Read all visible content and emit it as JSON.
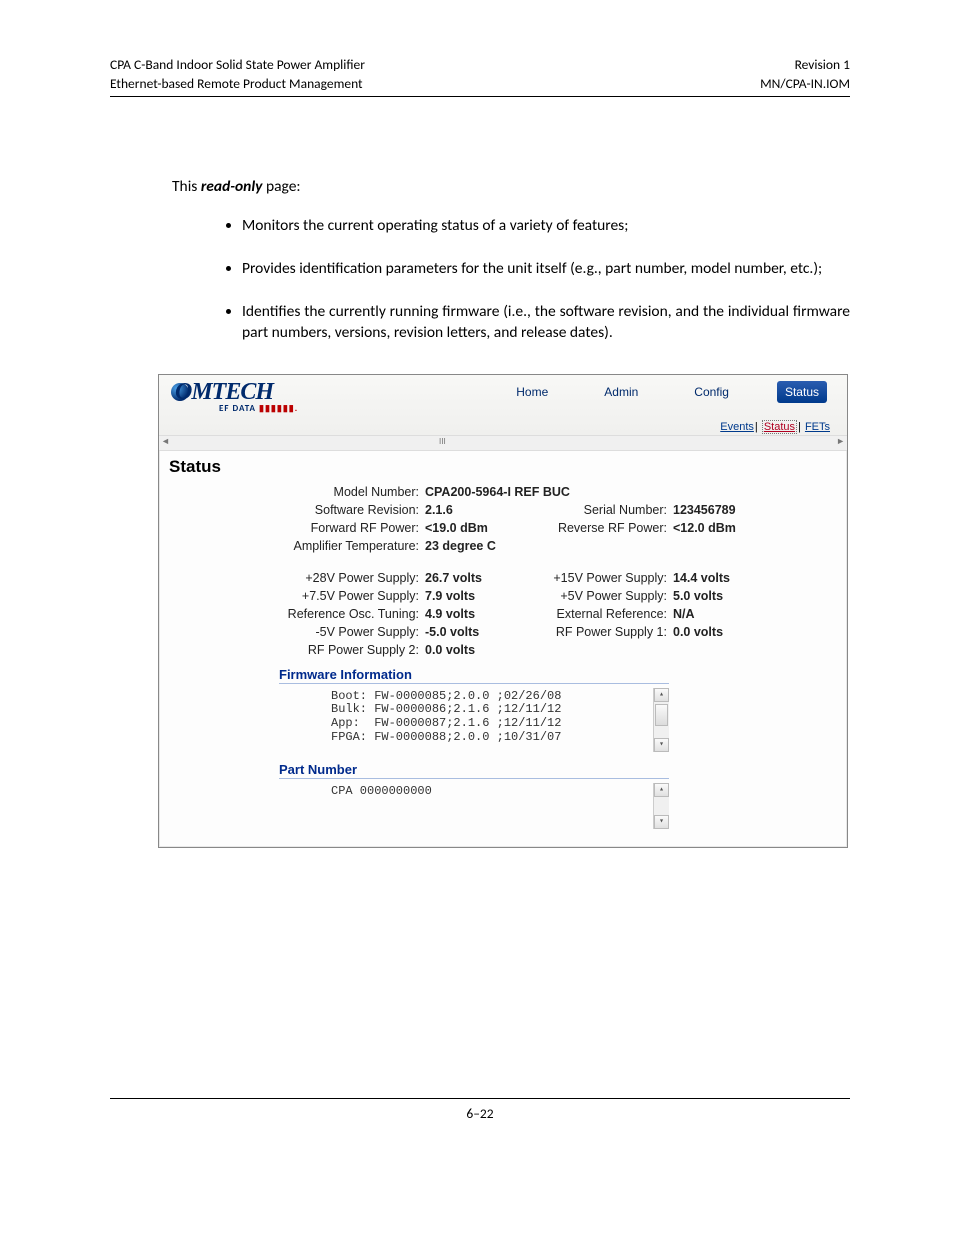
{
  "doc": {
    "header_left_1": "CPA C-Band Indoor Solid State Power Amplifier",
    "header_left_2": "Ethernet-based Remote Product Management",
    "header_right_1": "Revision 1",
    "header_right_2": "MN/CPA-IN.IOM",
    "intro_prefix": "This ",
    "intro_em": "read-only",
    "intro_suffix": " page:",
    "bullets": [
      "Monitors the current operating status of a variety of features;",
      "Provides identification parameters for the unit itself (e.g., part number, model number, etc.);",
      "Identifies the currently running firmware (i.e., the software revision, and the individual firmware part numbers, versions, revision letters, and release dates)."
    ],
    "page_number": "6–22"
  },
  "ui": {
    "logo_main": "OMTECH",
    "logo_sub": "EF DATA",
    "logo_bars": "▮▮▮▮▮▮.",
    "nav": {
      "home": "Home",
      "admin": "Admin",
      "config": "Config",
      "status": "Status"
    },
    "subnav": {
      "events": "Events",
      "status": "Status",
      "fets": "FETs",
      "sep": "|"
    },
    "page_title": "Status",
    "status": {
      "model_label": "Model Number:",
      "model": "CPA200-5964-I REF BUC",
      "sw_label": "Software Revision:",
      "sw": "2.1.6",
      "serial_label": "Serial Number:",
      "serial": "123456789",
      "fwd_label": "Forward RF Power:",
      "fwd": "<19.0 dBm",
      "rev_label": "Reverse RF Power:",
      "rev": "<12.0 dBm",
      "temp_label": "Amplifier Temperature:",
      "temp": "23 degree C",
      "p28_label": "+28V Power Supply:",
      "p28": "26.7 volts",
      "p15_label": "+15V Power Supply:",
      "p15": "14.4 volts",
      "p75_label": "+7.5V Power Supply:",
      "p75": "7.9 volts",
      "p5_label": "+5V Power Supply:",
      "p5": "5.0 volts",
      "osc_label": "Reference Osc. Tuning:",
      "osc": "4.9 volts",
      "ext_label": "External Reference:",
      "ext": "N/A",
      "n5_label": "-5V Power Supply:",
      "n5": "-5.0 volts",
      "rf1_label": "RF Power Supply 1:",
      "rf1": "0.0 volts",
      "rf2_label": "RF Power Supply 2:",
      "rf2": "0.0 volts"
    },
    "firmware": {
      "heading": "Firmware Information",
      "lines": "Boot: FW-0000085;2.0.0 ;02/26/08\nBulk: FW-0000086;2.1.6 ;12/11/12\nApp:  FW-0000087;2.1.6 ;12/11/12\nFPGA: FW-0000088;2.0.0 ;10/31/07"
    },
    "part": {
      "heading": "Part Number",
      "value": "CPA 0000000000"
    }
  }
}
